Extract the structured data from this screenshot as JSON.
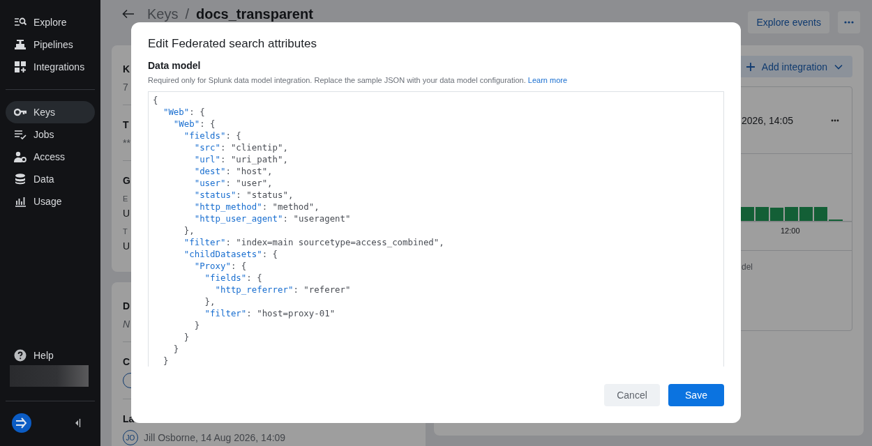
{
  "sidebar": {
    "groups": [
      [
        {
          "label": "Explore",
          "selected": false
        },
        {
          "label": "Pipelines",
          "selected": false
        },
        {
          "label": "Integrations",
          "selected": false
        }
      ],
      [
        {
          "label": "Keys",
          "selected": true
        },
        {
          "label": "Jobs",
          "selected": false
        },
        {
          "label": "Access",
          "selected": false
        },
        {
          "label": "Data",
          "selected": false
        },
        {
          "label": "Usage",
          "selected": false
        }
      ]
    ],
    "help": "Help"
  },
  "header": {
    "breadcrumb": [
      "Keys",
      "/",
      "docs_transparent"
    ],
    "explore_button": "Explore events"
  },
  "details_card": {
    "rows": [
      {
        "label": "K",
        "value": "7"
      },
      {
        "label": "T",
        "value": "**"
      }
    ],
    "group": {
      "label": "G",
      "fields": [
        {
          "label": "E",
          "value": "U"
        },
        {
          "label": "T",
          "value": "U"
        }
      ]
    }
  },
  "meta_card": {
    "description": {
      "label": "D",
      "value": "N"
    },
    "created": {
      "label": "C"
    },
    "last_modified": {
      "label": "La",
      "avatar": "JO",
      "text": "Jill Osborne, 14 Aug 2026, 14:09"
    }
  },
  "integrations": {
    "add_button": "Add integration",
    "timestamp": "2026, 14:05",
    "axis_label": "12:00",
    "footer": "del"
  },
  "modal": {
    "title": "Edit Federated search attributes",
    "field_label": "Data model",
    "help": "Required only for Splunk data model integration. Replace the sample JSON with your data model configuration.",
    "help_link": "Learn more",
    "code_lines": [
      [
        {
          "kind": "plain",
          "text": "{"
        }
      ],
      [
        {
          "kind": "key",
          "text": "  \"Web\""
        },
        {
          "kind": "plain",
          "text": ": {"
        }
      ],
      [
        {
          "kind": "key",
          "text": "    \"Web\""
        },
        {
          "kind": "plain",
          "text": ": {"
        }
      ],
      [
        {
          "kind": "key",
          "text": "      \"fields\""
        },
        {
          "kind": "plain",
          "text": ": {"
        }
      ],
      [
        {
          "kind": "key",
          "text": "        \"src\""
        },
        {
          "kind": "plain",
          "text": ": \"clientip\","
        }
      ],
      [
        {
          "kind": "key",
          "text": "        \"url\""
        },
        {
          "kind": "plain",
          "text": ": \"uri_path\","
        }
      ],
      [
        {
          "kind": "key",
          "text": "        \"dest\""
        },
        {
          "kind": "plain",
          "text": ": \"host\","
        }
      ],
      [
        {
          "kind": "key",
          "text": "        \"user\""
        },
        {
          "kind": "plain",
          "text": ": \"user\","
        }
      ],
      [
        {
          "kind": "key",
          "text": "        \"status\""
        },
        {
          "kind": "plain",
          "text": ": \"status\","
        }
      ],
      [
        {
          "kind": "key",
          "text": "        \"http_method\""
        },
        {
          "kind": "plain",
          "text": ": \"method\","
        }
      ],
      [
        {
          "kind": "key",
          "text": "        \"http_user_agent\""
        },
        {
          "kind": "plain",
          "text": ": \"useragent\""
        }
      ],
      [
        {
          "kind": "plain",
          "text": "      },"
        }
      ],
      [
        {
          "kind": "key",
          "text": "      \"filter\""
        },
        {
          "kind": "plain",
          "text": ": \"index=main sourcetype=access_combined\","
        }
      ],
      [
        {
          "kind": "key",
          "text": "      \"childDatasets\""
        },
        {
          "kind": "plain",
          "text": ": {"
        }
      ],
      [
        {
          "kind": "key",
          "text": "        \"Proxy\""
        },
        {
          "kind": "plain",
          "text": ": {"
        }
      ],
      [
        {
          "kind": "key",
          "text": "          \"fields\""
        },
        {
          "kind": "plain",
          "text": ": {"
        }
      ],
      [
        {
          "kind": "key",
          "text": "            \"http_referrer\""
        },
        {
          "kind": "plain",
          "text": ": \"referer\""
        }
      ],
      [
        {
          "kind": "plain",
          "text": "          },"
        }
      ],
      [
        {
          "kind": "key",
          "text": "          \"filter\""
        },
        {
          "kind": "plain",
          "text": ": \"host=proxy-01\""
        }
      ],
      [
        {
          "kind": "plain",
          "text": "        }"
        }
      ],
      [
        {
          "kind": "plain",
          "text": "      }"
        }
      ],
      [
        {
          "kind": "plain",
          "text": "    }"
        }
      ],
      [
        {
          "kind": "plain",
          "text": "  }"
        }
      ]
    ],
    "buttons": [
      {
        "label": "Cancel",
        "kind": "secondary"
      },
      {
        "label": "Save",
        "kind": "primary"
      }
    ]
  }
}
